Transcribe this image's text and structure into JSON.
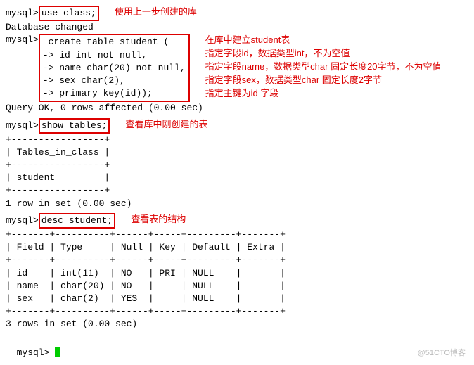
{
  "prompt": "mysql>",
  "cont": "    ->",
  "cmd1": " use class;",
  "note1": "使用上一步创建的库",
  "resp1": "Database changed",
  "cmd2_l1": " create table student (",
  "cmd2_l2": " id int not null,",
  "cmd2_l3": " name char(20) not null,",
  "cmd2_l4": " sex char(2),",
  "cmd2_l5": " primary key(id));",
  "note2_l1": "在库中建立student表",
  "note2_l2": "指定字段id，数据类型int，不为空值",
  "note2_l3": "指定字段name，数据类型char 固定长度20字节，不为空值",
  "note2_l4": "指定字段sex，数据类型char 固定长度2字节",
  "note2_l5": "指定主键为id 字段",
  "resp2": "Query OK, 0 rows affected (0.00 sec)",
  "cmd3": " show tables;",
  "note3": "查看库中刚创建的表",
  "table1_border": "+-----------------+",
  "table1_header": "| Tables_in_class |",
  "table1_row": "| student         |",
  "resp3": "1 row in set (0.00 sec)",
  "cmd4": " desc student;",
  "note4": "查看表的结构",
  "table2_border": "+-------+----------+------+-----+---------+-------+",
  "table2_header": "| Field | Type     | Null | Key | Default | Extra |",
  "table2_row1": "| id    | int(11)  | NO   | PRI | NULL    |       |",
  "table2_row2": "| name  | char(20) | NO   |     | NULL    |       |",
  "table2_row3": "| sex   | char(2)  | YES  |     | NULL    |       |",
  "resp4": "3 rows in set (0.00 sec)",
  "watermark": "@51CTO博客"
}
